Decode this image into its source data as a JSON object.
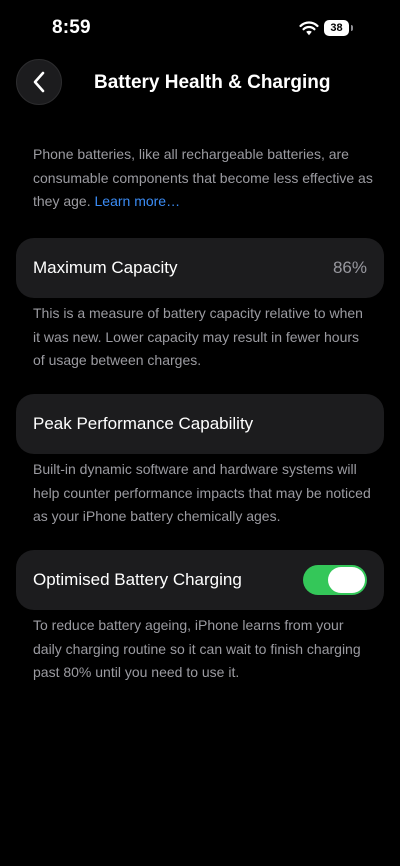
{
  "status_bar": {
    "time": "8:59",
    "battery_level": "38",
    "icons": [
      "wifi-icon",
      "battery-icon"
    ]
  },
  "nav": {
    "title": "Battery Health & Charging",
    "back_icon": "chevron-left-icon"
  },
  "intro": {
    "text": "Phone batteries, like all rechargeable batteries, are consumable components that become less effective as they age.",
    "link_label": "Learn more…"
  },
  "maximum_capacity": {
    "label": "Maximum Capacity",
    "value": "86%",
    "description": "This is a measure of battery capacity relative to when it was new. Lower capacity may result in fewer hours of usage between charges."
  },
  "peak_performance": {
    "label": "Peak Performance Capability",
    "description": "Built-in dynamic software and hardware systems will help counter performance impacts that may be noticed as your iPhone battery chemically ages."
  },
  "optimised_charging": {
    "label": "Optimised Battery Charging",
    "toggle_on": true,
    "description": "To reduce battery ageing, iPhone learns from your daily charging routine so it can wait to finish charging past 80% until you need to use it."
  },
  "colors": {
    "background": "#000000",
    "card": "#1c1c1e",
    "secondary_text": "#9b9ba1",
    "link": "#3b8cf5",
    "toggle_on": "#34c759"
  }
}
